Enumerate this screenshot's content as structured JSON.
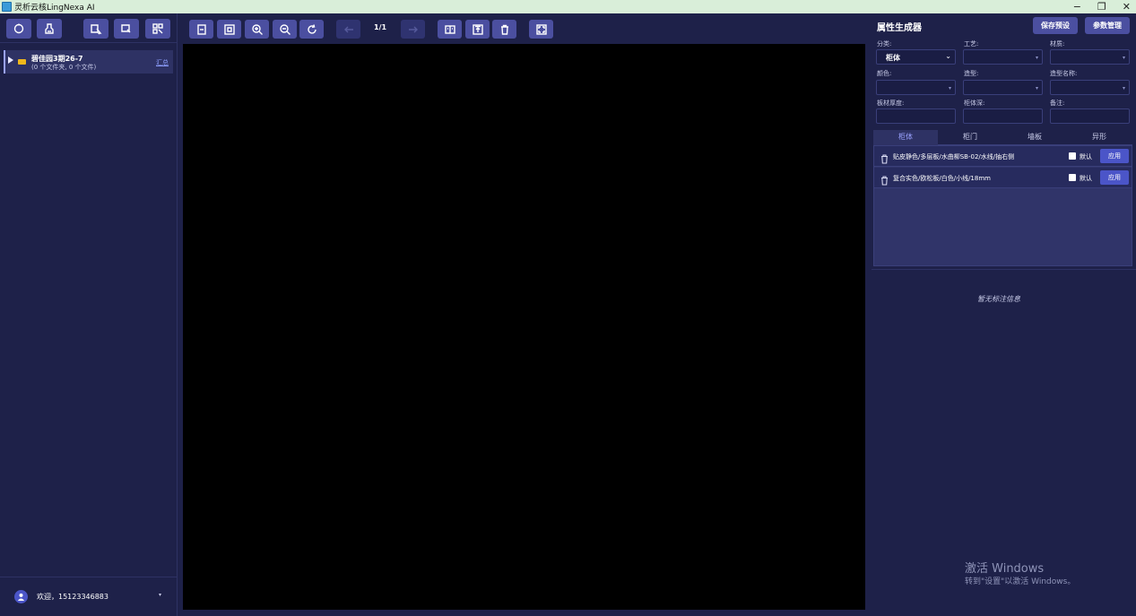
{
  "window": {
    "title": "灵析云核LingNexa AI",
    "minimize_glyph": "−",
    "restore_glyph": "❐",
    "close_glyph": "✕"
  },
  "left_toolbar": {
    "buttons": [
      "refresh-icon",
      "cleanup-icon",
      "select-file-icon",
      "select-folder-icon",
      "scan-icon"
    ]
  },
  "file_tree": {
    "items": [
      {
        "name": "碧佳园3期26-7",
        "subtitle": "(0 个文件夹, 0 个文件)",
        "summary_link": "汇总"
      }
    ]
  },
  "user": {
    "welcome": "欢迎，15123346883",
    "caret": "▾"
  },
  "viewer_toolbar": {
    "page_indicator": "1/1",
    "buttons": [
      "fit-page-icon",
      "fit-width-icon",
      "zoom-in-icon",
      "zoom-out-icon",
      "rotate-icon",
      "prev-page-icon",
      "next-page-icon",
      "compare-icon",
      "export-icon",
      "delete-icon",
      "fullscreen-icon"
    ]
  },
  "property_panel": {
    "title": "属性生成器",
    "save_preset": "保存预设",
    "param_manage": "参数管理",
    "fields": {
      "category": {
        "label": "分类:",
        "value": "柜体"
      },
      "process": {
        "label": "工艺:",
        "value": ""
      },
      "material": {
        "label": "材质:",
        "value": ""
      },
      "color": {
        "label": "颜色:",
        "value": ""
      },
      "shape": {
        "label": "造型:",
        "value": ""
      },
      "shape_name": {
        "label": "造型名称:",
        "value": ""
      },
      "board_thickness": {
        "label": "板材厚度:",
        "value": ""
      },
      "cabinet_depth": {
        "label": "柜体深:",
        "value": ""
      },
      "note": {
        "label": "备注:",
        "value": ""
      }
    },
    "tabs": [
      "柜体",
      "柜门",
      "墙板",
      "异形"
    ],
    "active_tab": "柜体",
    "presets": [
      {
        "text": "贴皮静色/多层板/水曲柳SB-02/水线/抽右侧",
        "default_label": "默认",
        "apply_label": "应用"
      },
      {
        "text": "复合实色/欧松板/白色/小线/18mm",
        "default_label": "默认",
        "apply_label": "应用"
      }
    ],
    "no_annotation": "暂无标注信息"
  },
  "watermark": {
    "line1": "激活 Windows",
    "line2": "转到\"设置\"以激活 Windows。"
  }
}
